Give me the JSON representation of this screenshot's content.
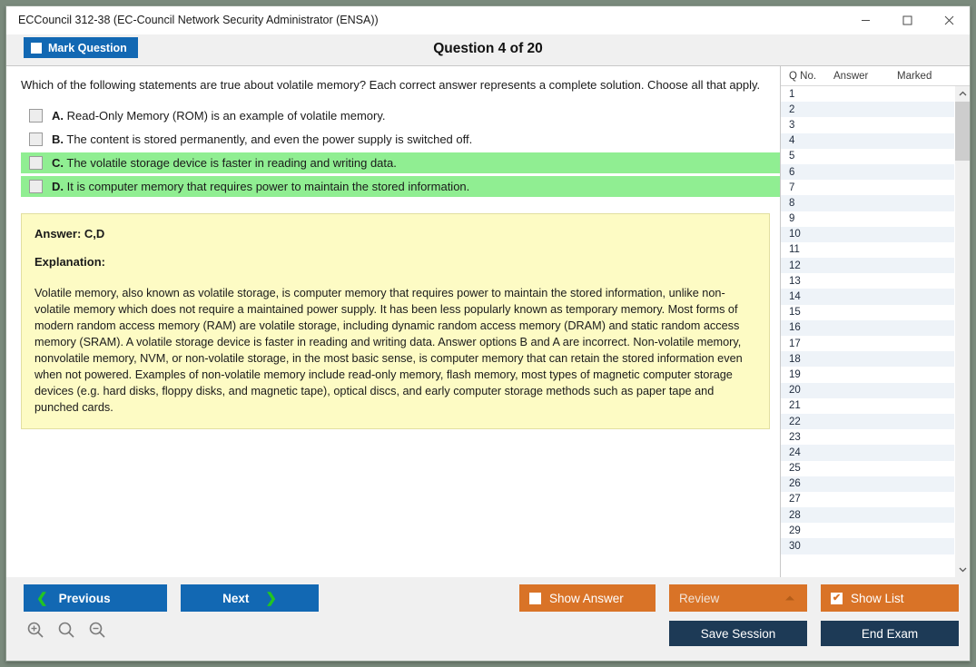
{
  "window": {
    "title": "ECCouncil 312-38 (EC-Council Network Security Administrator (ENSA))",
    "minimize_label": "Minimize",
    "maximize_label": "Maximize",
    "close_label": "Close"
  },
  "header": {
    "mark_question_label": "Mark Question",
    "question_title": "Question 4 of 20"
  },
  "question": {
    "text": "Which of the following statements are true about volatile memory? Each correct answer represents a complete solution. Choose all that apply.",
    "options": [
      {
        "letter": "A.",
        "text": "Read-Only Memory (ROM) is an example of volatile memory.",
        "correct": false,
        "checked": false
      },
      {
        "letter": "B.",
        "text": "The content is stored permanently, and even the power supply is switched off.",
        "correct": false,
        "checked": false
      },
      {
        "letter": "C.",
        "text": "The volatile storage device is faster in reading and writing data.",
        "correct": true,
        "checked": false
      },
      {
        "letter": "D.",
        "text": "It is computer memory that requires power to maintain the stored information.",
        "correct": true,
        "checked": false
      }
    ]
  },
  "explanation": {
    "answer_label": "Answer: C,D",
    "explanation_label": "Explanation:",
    "body": "Volatile memory, also known as volatile storage, is computer memory that requires power to maintain the stored information, unlike non-volatile memory which does not require a maintained power supply. It has been less popularly known as temporary memory. Most forms of modern random access memory (RAM) are volatile storage, including dynamic random access memory (DRAM) and static random access memory (SRAM). A volatile storage device is faster in reading and writing data. Answer options B and A are incorrect. Non-volatile memory, nonvolatile memory, NVM, or non-volatile storage, in the most basic sense, is computer memory that can retain the stored information even when not powered. Examples of non-volatile memory include read-only memory, flash memory, most types of magnetic computer storage devices (e.g. hard disks, floppy disks, and magnetic tape), optical discs, and early computer storage methods such as paper tape and punched cards."
  },
  "question_list": {
    "columns": [
      "Q No.",
      "Answer",
      "Marked"
    ],
    "rows": [
      {
        "qno": "1",
        "answer": "",
        "marked": ""
      },
      {
        "qno": "2",
        "answer": "",
        "marked": ""
      },
      {
        "qno": "3",
        "answer": "",
        "marked": ""
      },
      {
        "qno": "4",
        "answer": "",
        "marked": ""
      },
      {
        "qno": "5",
        "answer": "",
        "marked": ""
      },
      {
        "qno": "6",
        "answer": "",
        "marked": ""
      },
      {
        "qno": "7",
        "answer": "",
        "marked": ""
      },
      {
        "qno": "8",
        "answer": "",
        "marked": ""
      },
      {
        "qno": "9",
        "answer": "",
        "marked": ""
      },
      {
        "qno": "10",
        "answer": "",
        "marked": ""
      },
      {
        "qno": "11",
        "answer": "",
        "marked": ""
      },
      {
        "qno": "12",
        "answer": "",
        "marked": ""
      },
      {
        "qno": "13",
        "answer": "",
        "marked": ""
      },
      {
        "qno": "14",
        "answer": "",
        "marked": ""
      },
      {
        "qno": "15",
        "answer": "",
        "marked": ""
      },
      {
        "qno": "16",
        "answer": "",
        "marked": ""
      },
      {
        "qno": "17",
        "answer": "",
        "marked": ""
      },
      {
        "qno": "18",
        "answer": "",
        "marked": ""
      },
      {
        "qno": "19",
        "answer": "",
        "marked": ""
      },
      {
        "qno": "20",
        "answer": "",
        "marked": ""
      },
      {
        "qno": "21",
        "answer": "",
        "marked": ""
      },
      {
        "qno": "22",
        "answer": "",
        "marked": ""
      },
      {
        "qno": "23",
        "answer": "",
        "marked": ""
      },
      {
        "qno": "24",
        "answer": "",
        "marked": ""
      },
      {
        "qno": "25",
        "answer": "",
        "marked": ""
      },
      {
        "qno": "26",
        "answer": "",
        "marked": ""
      },
      {
        "qno": "27",
        "answer": "",
        "marked": ""
      },
      {
        "qno": "28",
        "answer": "",
        "marked": ""
      },
      {
        "qno": "29",
        "answer": "",
        "marked": ""
      },
      {
        "qno": "30",
        "answer": "",
        "marked": ""
      }
    ]
  },
  "footer": {
    "previous_label": "Previous",
    "next_label": "Next",
    "show_answer_label": "Show Answer",
    "review_label": "Review",
    "show_list_label": "Show List",
    "show_list_checked": "✔",
    "save_session_label": "Save Session",
    "end_exam_label": "End Exam",
    "zoom_in_icon": "zoom-in-icon",
    "zoom_reset_icon": "zoom-reset-icon",
    "zoom_out_icon": "zoom-out-icon"
  },
  "colors": {
    "primary_blue": "#1268b3",
    "orange": "#d97327",
    "navy": "#1d3a56",
    "correct_green": "#90ee92",
    "explanation_yellow": "#fdfbc4",
    "chevron_green": "#22c522"
  }
}
